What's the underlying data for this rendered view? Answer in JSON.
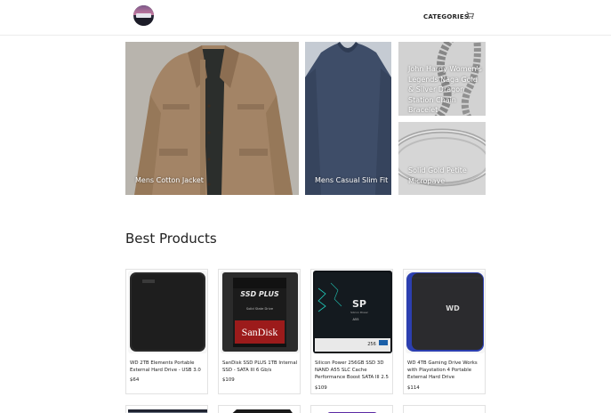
{
  "header": {
    "nav_categories": "CATEGORIES",
    "cart_icon": "cart-icon"
  },
  "features": [
    {
      "label": "Mens Cotton Jacket"
    },
    {
      "label": "Mens Casual Slim Fit"
    },
    {
      "label": "John Hardy Women's Legends Naga Gold & Silver Dragon Station Chain Bracelet"
    },
    {
      "label": "Solid Gold Petite Micropave"
    }
  ],
  "best_products": {
    "title": "Best Products",
    "items": [
      {
        "name": "WD 2TB Elements Portable External Hard Drive - USB 3.0",
        "price": "$64"
      },
      {
        "name": "SanDisk SSD PLUS 1TB Internal SSD - SATA III 6 Gb/s",
        "price": "$109"
      },
      {
        "name": "Silicon Power 256GB SSD 3D NAND A55 SLC Cache Performance Boost SATA III 2.5",
        "price": "$109"
      },
      {
        "name": "WD 4TB Gaming Drive Works with Playstation 4 Portable External Hard Drive",
        "price": "$114"
      }
    ]
  },
  "product_art": {
    "sandisk_badge": "SSD PLUS",
    "sandisk_sub": "Solid State Drive",
    "sandisk_brand": "SanDisk",
    "sp_brand": "SP",
    "sp_sub": "Silicon Power",
    "sp_model": "A55",
    "sp_capacity": "256",
    "wd_logo": "WD"
  }
}
